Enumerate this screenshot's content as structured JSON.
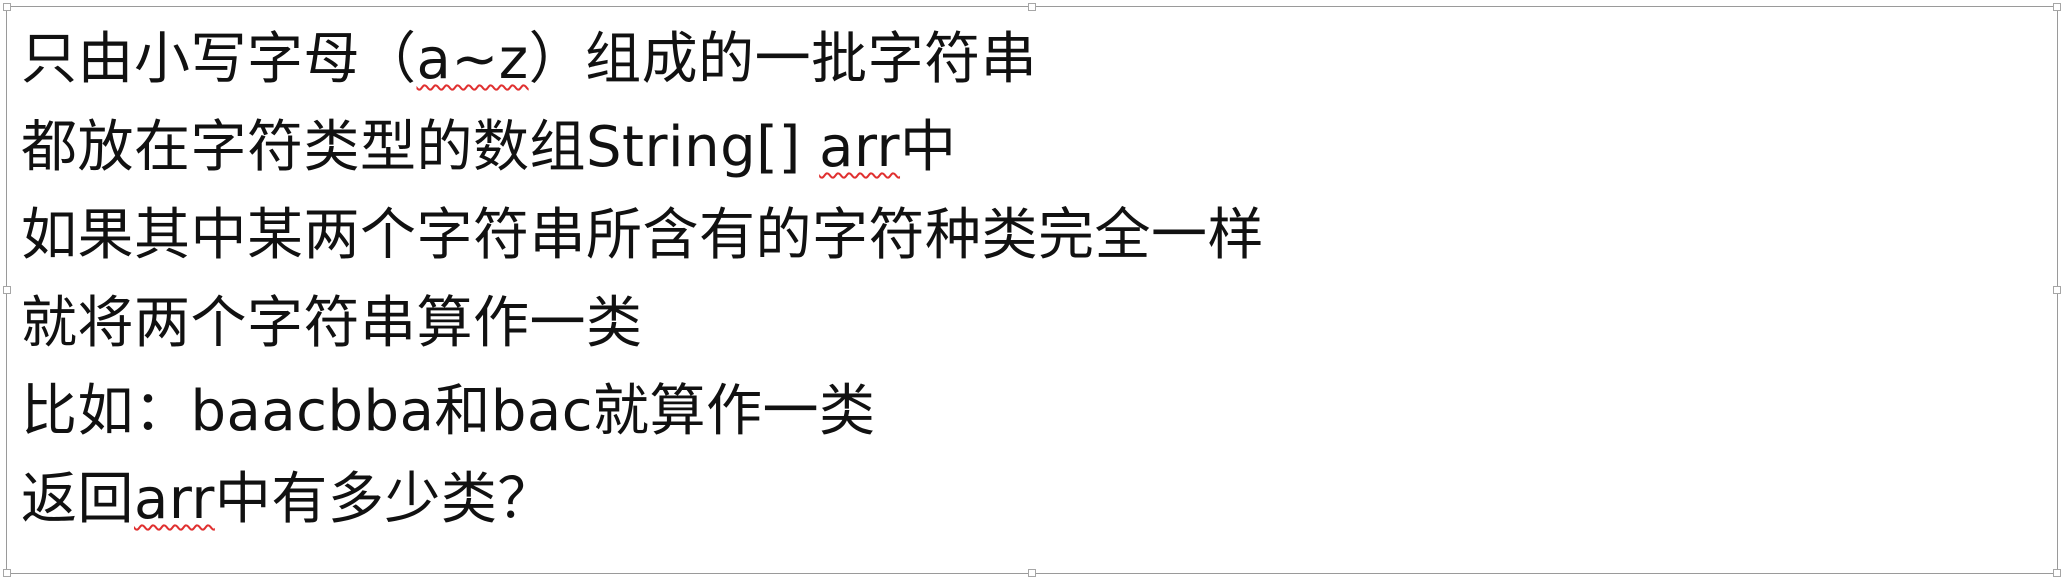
{
  "document": {
    "lines": [
      {
        "before": "只由小写字母（",
        "flag": "a~z",
        "after": "）组成的一批字符串"
      },
      {
        "before": "都放在字符类型的数组String[] ",
        "flag": "arr",
        "after": "中"
      },
      {
        "before": "如果其中某两个字符串所含有的字符种类完全一样",
        "flag": "",
        "after": ""
      },
      {
        "before": "就将两个字符串算作一类",
        "flag": "",
        "after": ""
      },
      {
        "before": "比如：baacbba和bac就算作一类",
        "flag": "",
        "after": ""
      },
      {
        "before": "返回",
        "flag": "arr",
        "after": "中有多少类？"
      }
    ]
  },
  "colors": {
    "text": "#111111",
    "spellcheck_underline": "#e03030",
    "frame_border": "#9a9a9a"
  }
}
